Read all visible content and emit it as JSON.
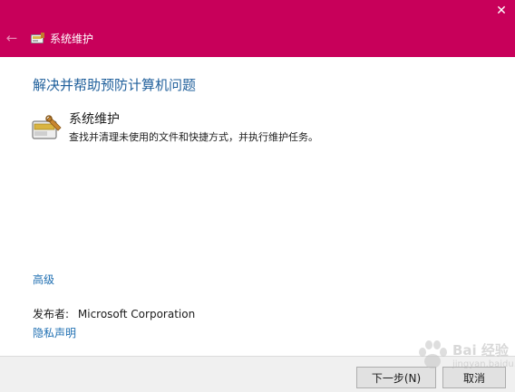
{
  "window": {
    "title": "系统维护",
    "back_icon": "back-arrow-icon",
    "close_icon": "close-icon",
    "accent_color": "#c8005a"
  },
  "main": {
    "heading": "解决并帮助预防计算机问题",
    "task": {
      "title": "系统维护",
      "description": "查找并清理未使用的文件和快捷方式，并执行维护任务。",
      "icon": "maintenance-tools-icon"
    },
    "advanced_link": "高级",
    "publisher_label": "发布者:",
    "publisher_name": "Microsoft Corporation",
    "privacy_link": "隐私声明"
  },
  "footer": {
    "next_label": "下一步(N)",
    "cancel_label": "取消"
  },
  "watermark": {
    "brand": "Bai 经验",
    "url": "jingyan.baidu.com"
  }
}
